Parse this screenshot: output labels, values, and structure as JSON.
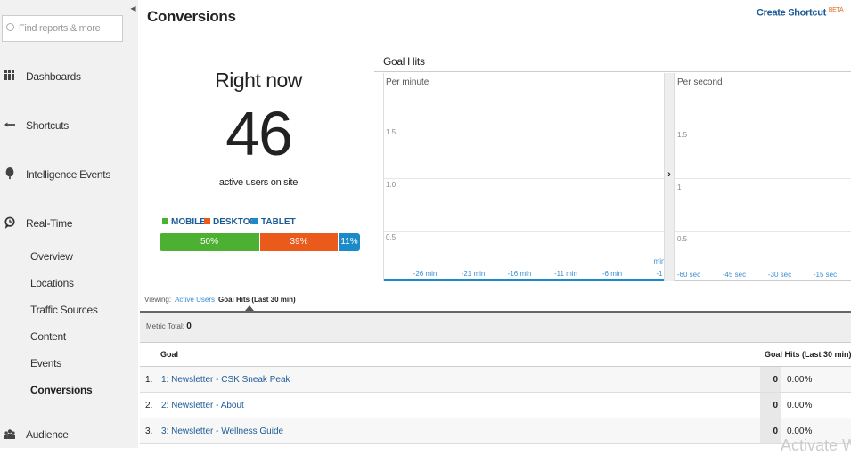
{
  "sidebar": {
    "search_placeholder": "Find reports & more",
    "items": [
      {
        "label": "Dashboards",
        "icon": "grid-icon"
      },
      {
        "label": "Shortcuts",
        "icon": "arrow-left-icon"
      },
      {
        "label": "Intelligence Events",
        "icon": "lightbulb-icon"
      },
      {
        "label": "Real-Time",
        "icon": "clock-icon"
      },
      {
        "label": "Audience",
        "icon": "people-icon"
      }
    ],
    "subitems": [
      "Overview",
      "Locations",
      "Traffic Sources",
      "Content",
      "Events",
      "Conversions"
    ],
    "active_subitem": "Conversions"
  },
  "header": {
    "title": "Conversions",
    "shortcut": "Create Shortcut",
    "beta": "BETA"
  },
  "rightnow": {
    "title": "Right now",
    "count": "46",
    "caption": "active users on site",
    "legend": [
      {
        "label": "MOBILE",
        "color": "#4cb132"
      },
      {
        "label": "DESKTOP",
        "color": "#ea5a1a"
      },
      {
        "label": "TABLET",
        "color": "#1a8ac8"
      }
    ],
    "segments": [
      {
        "label": "50%",
        "value": 50
      },
      {
        "label": "39%",
        "value": 39
      },
      {
        "label": "11%",
        "value": 11
      }
    ]
  },
  "goalhits": {
    "title": "Goal Hits",
    "per_minute": {
      "label": "Per minute",
      "yticks": [
        "1.5",
        "1.0",
        "0.5"
      ],
      "xticks": [
        "-26 min",
        "-21 min",
        "-16 min",
        "-11 min",
        "-6 min",
        "-1"
      ],
      "unit": "min"
    },
    "per_second": {
      "label": "Per second",
      "yticks": [
        "1.5",
        "1",
        "0.5"
      ],
      "xticks": [
        "-60 sec",
        "-45 sec",
        "-30 sec",
        "-15 sec"
      ]
    }
  },
  "viewing": {
    "label": "Viewing:",
    "option1": "Active Users",
    "option2": "Goal Hits (Last 30 min)"
  },
  "metric": {
    "label": "Metric Total:",
    "value": "0"
  },
  "table": {
    "col_goal": "Goal",
    "col_hits": "Goal Hits (Last 30 min)",
    "rows": [
      {
        "n": "1.",
        "goal": "1: Newsletter - CSK Sneak Peak",
        "hits": "0",
        "pct": "0.00%"
      },
      {
        "n": "2.",
        "goal": "2: Newsletter - About",
        "hits": "0",
        "pct": "0.00%"
      },
      {
        "n": "3.",
        "goal": "3: Newsletter - Wellness Guide",
        "hits": "0",
        "pct": "0.00%"
      }
    ]
  },
  "watermark": "Activate W"
}
